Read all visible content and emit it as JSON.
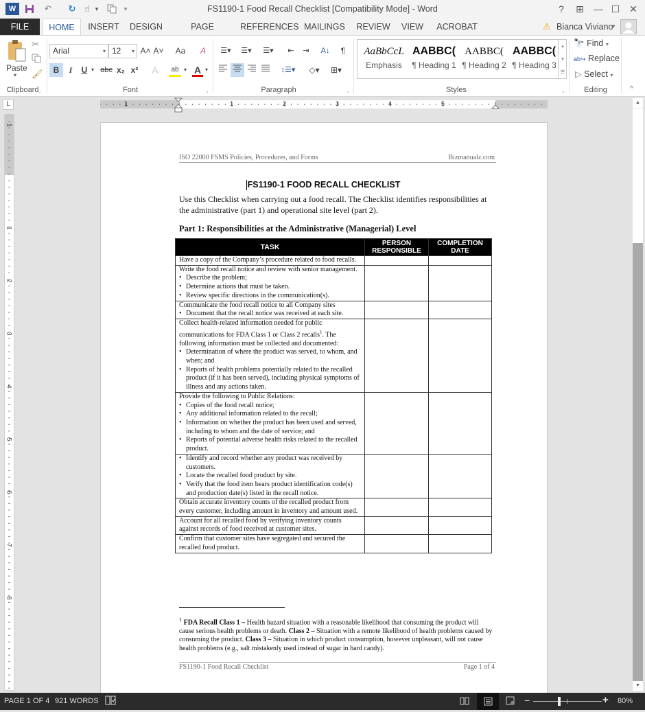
{
  "window": {
    "title": "FS1190-1 Food Recall Checklist [Compatibility Mode] - Word",
    "help_label": "?",
    "ribbon_display_label": "⊞",
    "minimize_label": "—",
    "maximize_label": "☐",
    "close_label": "✕"
  },
  "quick_access": {
    "word_icon": "W",
    "save_icon": "💾",
    "undo_icon": "↶",
    "redo_icon": "↻",
    "touch_icon": "☝",
    "customize_icon": "▾"
  },
  "tabs": [
    {
      "label": "FILE"
    },
    {
      "label": "HOME"
    },
    {
      "label": "INSERT"
    },
    {
      "label": "DESIGN"
    },
    {
      "label": "PAGE LAYOUT"
    },
    {
      "label": "REFERENCES"
    },
    {
      "label": "MAILINGS"
    },
    {
      "label": "REVIEW"
    },
    {
      "label": "VIEW"
    },
    {
      "label": "ACROBAT"
    }
  ],
  "user": {
    "name": "Bianca Viviano",
    "warning_icon": "⚠",
    "dropdown": "▾"
  },
  "ribbon": {
    "clipboard": {
      "paste_label": "Paste",
      "group_label": "Clipboard"
    },
    "font": {
      "font_name": "Arial",
      "font_size": "12",
      "grow": "A˄",
      "shrink": "A˅",
      "change_case": "Aa",
      "clear": "A",
      "bold": "B",
      "italic": "I",
      "underline": "U",
      "strike": "abc",
      "subscript": "x₂",
      "superscript": "x²",
      "text_effects": "A",
      "highlight": "ab",
      "font_color": "A",
      "group_label": "Font"
    },
    "paragraph": {
      "group_label": "Paragraph",
      "sort": "A↓",
      "pilcrow": "¶"
    },
    "styles": {
      "items": [
        {
          "preview": "AaBbCcL",
          "name": "Emphasis"
        },
        {
          "preview": "AABBC(",
          "name": "¶ Heading 1"
        },
        {
          "preview": "AABBC(",
          "name": "¶ Heading 2"
        },
        {
          "preview": "AABBC(",
          "name": "¶ Heading 3"
        }
      ],
      "group_label": "Styles"
    },
    "editing": {
      "find": "Find",
      "replace": "Replace",
      "select": "Select",
      "group_label": "Editing"
    }
  },
  "ruler": {
    "tab_selector": "L",
    "numbers": [
      "1",
      "1",
      "2",
      "3",
      "4",
      "5"
    ]
  },
  "vruler": {
    "numbers": [
      "1",
      "1",
      "2",
      "3",
      "4",
      "5",
      "6",
      "7",
      "8"
    ]
  },
  "document": {
    "header_left": "ISO 22000 FSMS Policies, Procedures, and Forms",
    "header_right": "Bizmanualz.com",
    "title": "FS1190-1 FOOD RECALL CHECKLIST",
    "intro": "Use this Checklist when carrying out a food recall. The Checklist identifies responsibilities at the administrative (part 1) and operational site level (part 2).",
    "part1_heading": "Part 1: Responsibilities at the Administrative (Managerial) Level",
    "table": {
      "headers": [
        "TASK",
        "PERSON RESPONSIBLE",
        "COMPLETION DATE"
      ],
      "rows": [
        {
          "text": "Have a copy of the Company’s procedure related to food recalls.",
          "bullets": []
        },
        {
          "text": "Write the food recall notice and review with senior management.",
          "bullets": [
            "Describe the problem;",
            "Determine actions that must be taken.",
            "Review specific directions in the communication(s)."
          ]
        },
        {
          "text": "Communicate the food recall notice to all Company sites",
          "bullets": [
            "Document that the recall notice was received at each site."
          ]
        },
        {
          "text": "Collect health-related information needed for public communications for FDA Class 1 or Class 2 recalls",
          "footnote_ref": "1",
          "text_after": ". The following information must be collected and documented:",
          "bullets": [
            "Determination of where the product was served, to whom, and when; and",
            "Reports of health problems potentially related to the recalled product (if it has been served), including physical symptoms of illness and any actions taken."
          ]
        },
        {
          "text": "Provide the following to Public Relations:",
          "bullets": [
            "Copies of the food recall notice;",
            "Any additional information related to the recall;",
            "Information on whether the product has been used and served, including to whom and the date of service; and",
            "Reports of potential adverse health risks related to the recalled product."
          ]
        },
        {
          "text": "",
          "bullets": [
            "Identify and record whether any product was received by customers.",
            "Locate the recalled food product by site.",
            "Verify that the food item bears product identification code(s) and production date(s) listed in the recall notice."
          ]
        },
        {
          "text": "Obtain accurate inventory counts of the recalled product from every customer, including amount in inventory and amount used.",
          "bullets": []
        },
        {
          "text": "Account for all recalled food by verifying inventory counts against records of food received at customer sites.",
          "bullets": []
        },
        {
          "text": "Confirm that customer sites have segregated and secured the recalled food product.",
          "bullets": []
        }
      ]
    },
    "footnote": {
      "ref": "1",
      "class1_label": "FDA Recall Class 1 –",
      "class1_text": " Health hazard situation with a reasonable likelihood that consuming the product will cause serious health problems or death.  ",
      "class2_label": "Class 2 –",
      "class2_text": " Situation with a remote likelihood of health problems caused by consuming the product.  ",
      "class3_label": "Class 3 –",
      "class3_text": " Situation in which product consumption, however unpleasant, will not cause health problems (e.g., salt mistakenly used instead of sugar in hard candy)."
    },
    "footer_left": "FS1190-1 Food Recall Checklist",
    "footer_right": "Page 1 of 4"
  },
  "status": {
    "page": "PAGE 1 OF 4",
    "words": "921 WORDS",
    "zoom_minus": "−",
    "zoom_plus": "+",
    "zoom_level": "80%",
    "zoom_percent": 80
  }
}
